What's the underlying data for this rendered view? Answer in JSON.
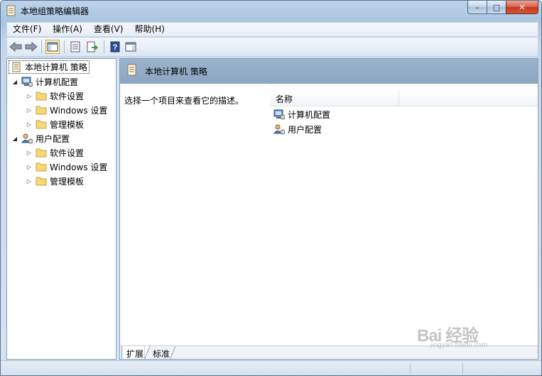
{
  "window": {
    "title": "本地组策略编辑器",
    "controls": {
      "minimize": "–",
      "maximize": "□",
      "close": "✕"
    }
  },
  "menubar": {
    "items": [
      {
        "label": "文件(F)"
      },
      {
        "label": "操作(A)"
      },
      {
        "label": "查看(V)"
      },
      {
        "label": "帮助(H)"
      }
    ]
  },
  "toolbar": {
    "buttons": [
      {
        "icon": "back-arrow-icon"
      },
      {
        "icon": "forward-arrow-icon"
      },
      {
        "icon": "show-hide-console-tree-icon"
      },
      {
        "icon": "properties-icon"
      },
      {
        "icon": "export-list-icon"
      },
      {
        "icon": "help-icon"
      },
      {
        "icon": "show-action-pane-icon"
      }
    ]
  },
  "tree": {
    "root": {
      "label": "本地计算机 策略"
    },
    "nodes": [
      {
        "label": "计算机配置",
        "icon": "computer-config-icon"
      },
      {
        "label": "软件设置",
        "icon": "folder-icon"
      },
      {
        "label": "Windows 设置",
        "icon": "folder-icon"
      },
      {
        "label": "管理模板",
        "icon": "folder-icon"
      },
      {
        "label": "用户配置",
        "icon": "user-config-icon"
      },
      {
        "label": "软件设置",
        "icon": "folder-icon"
      },
      {
        "label": "Windows 设置",
        "icon": "folder-icon"
      },
      {
        "label": "管理模板",
        "icon": "folder-icon"
      }
    ]
  },
  "details": {
    "header_title": "本地计算机 策略",
    "description": "选择一个项目来查看它的描述。",
    "column_name": "名称",
    "items": [
      {
        "label": "计算机配置",
        "icon": "computer-config-icon"
      },
      {
        "label": "用户配置",
        "icon": "user-config-icon"
      }
    ],
    "tabs": [
      {
        "label": "扩展"
      },
      {
        "label": "标准"
      }
    ]
  },
  "watermark": {
    "logo": "Bai 经验",
    "subtitle": "jingyan.baidu.com"
  },
  "colors": {
    "header_blue": "#8ba5c2",
    "window_frame": "#bcd3ea",
    "close_red": "#c4361c"
  }
}
